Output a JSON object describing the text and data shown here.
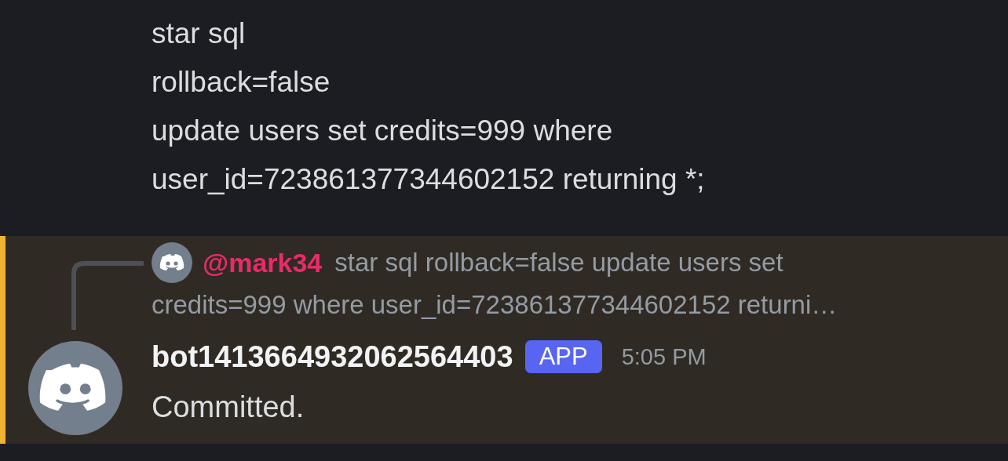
{
  "previous_message": {
    "lines": [
      "star sql",
      "rollback=false",
      "update users set credits=999 where",
      "user_id=723861377344602152 returning *;"
    ]
  },
  "message": {
    "highlighted": true,
    "reply": {
      "author": "@mark34",
      "content_lines": [
        "star sql rollback=false update users set",
        "credits=999 where user_id=723861377344602152 returni…"
      ]
    },
    "author": "bot1413664932062564403",
    "badge": "APP",
    "timestamp": "5:05 PM",
    "content": "Committed."
  }
}
